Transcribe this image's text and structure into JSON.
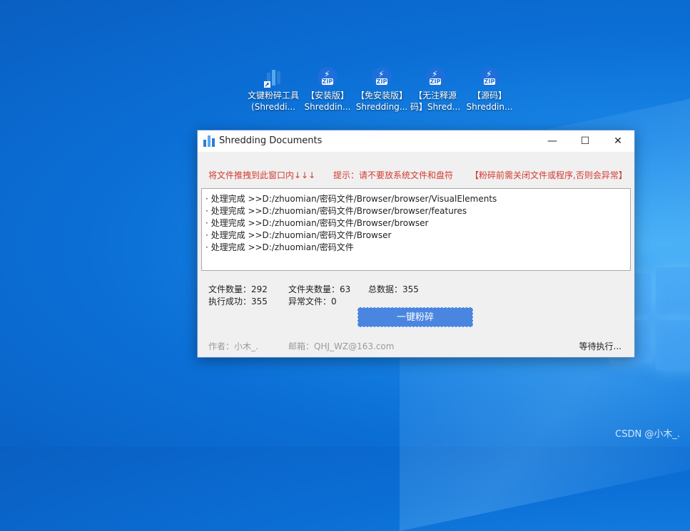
{
  "desktop": {
    "icons": [
      {
        "label_line1": "文键粉碎工具",
        "label_line2": "(Shreddi...",
        "icon": "app-shortcut-icon"
      },
      {
        "label_line1": "【安装版】",
        "label_line2": "Shreddin...",
        "icon": "zip-icon"
      },
      {
        "label_line1": "【免安装版】",
        "label_line2": "Shredding...",
        "icon": "zip-icon"
      },
      {
        "label_line1": "【无注释源",
        "label_line2": "码】Shred...",
        "icon": "zip-icon"
      },
      {
        "label_line1": "【源码】",
        "label_line2": "Shreddin...",
        "icon": "zip-icon"
      }
    ],
    "watermark": "CSDN @小木_."
  },
  "window": {
    "title": "Shredding Documents",
    "controls": {
      "minimize": "—",
      "maximize": "☐",
      "close": "✕"
    },
    "hints": {
      "drag": "将文件推拽到此窗口内↓↓↓",
      "tip": "提示：请不要放系统文件和盘符",
      "warning": "【粉碎前需关闭文件或程序,否则会异常】"
    },
    "log": [
      "· 处理完成 >>D:/zhuomian/密码文件/Browser/browser/VisualElements",
      "· 处理完成 >>D:/zhuomian/密码文件/Browser/browser/features",
      "· 处理完成 >>D:/zhuomian/密码文件/Browser/browser",
      "· 处理完成 >>D:/zhuomian/密码文件/Browser",
      "· 处理完成 >>D:/zhuomian/密码文件"
    ],
    "stats": {
      "file_count": "文件数量：292",
      "folder_count": "文件夹数量：63",
      "total": "总数据：355",
      "success": "执行成功：355",
      "errors": "异常文件：0"
    },
    "shred_button": "一键粉碎",
    "footer": {
      "author": "作者：小木_.",
      "email": "邮箱：QHJ_WZ@163.com"
    },
    "status": "等待执行..."
  },
  "colors": {
    "accent": "#4a86e0",
    "hint_red": "#d43a2f",
    "desktop_blue": "#0b6fd6"
  }
}
